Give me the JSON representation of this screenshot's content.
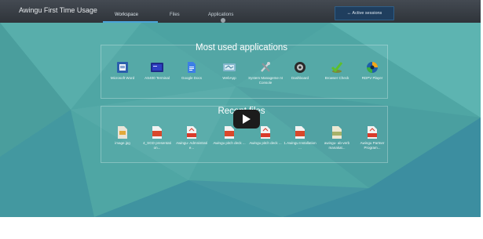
{
  "header": {
    "app_title": "Awingu First Time Usage",
    "tabs": [
      {
        "label": "Workspace",
        "active": true
      },
      {
        "label": "Files",
        "active": false
      },
      {
        "label": "Applications",
        "active": false
      }
    ],
    "active_sessions_label": "Active sessions"
  },
  "apps_section": {
    "title": "Most used applications",
    "items": [
      {
        "label": "Microsoft Word",
        "icon": "word-icon"
      },
      {
        "label": "AS400 Terminal",
        "icon": "terminal-icon"
      },
      {
        "label": "Google Docs",
        "icon": "google-docs-icon"
      },
      {
        "label": "WebApp",
        "icon": "webapp-icon"
      },
      {
        "label": "System Manageme nt Console",
        "icon": "tools-icon"
      },
      {
        "label": "Dashboard",
        "icon": "dashboard-icon"
      },
      {
        "label": "Browser Check",
        "icon": "checkmark-icon"
      },
      {
        "label": "RDPV Player",
        "icon": "media-player-icon"
      }
    ]
  },
  "files_section": {
    "title": "Recent files",
    "items": [
      {
        "label": "image.jpg",
        "icon": "image-file-icon"
      },
      {
        "label": "4_SGD presentati on...",
        "icon": "pptx-file-icon"
      },
      {
        "label": "Awingu- Admnistrati e...",
        "icon": "pdf-file-icon"
      },
      {
        "label": "Awingu pitch deck ...",
        "icon": "pptx-file-icon"
      },
      {
        "label": "Awingu pitch deck ...",
        "icon": "pdf-file-icon"
      },
      {
        "label": "1.Awingu Installation ...",
        "icon": "pptx-file-icon"
      },
      {
        "label": "awingu- ab-verb manakat...",
        "icon": "html-file-icon"
      },
      {
        "label": "Awingu Partner Program...",
        "icon": "pdf-file-icon"
      }
    ]
  },
  "video": {
    "play_icon": "play-icon"
  },
  "colors": {
    "background": "#4fa6a4",
    "topbar": "#363b41",
    "accent_tab": "#4aa3d8",
    "active_sessions_bg": "#1f3e5e"
  }
}
